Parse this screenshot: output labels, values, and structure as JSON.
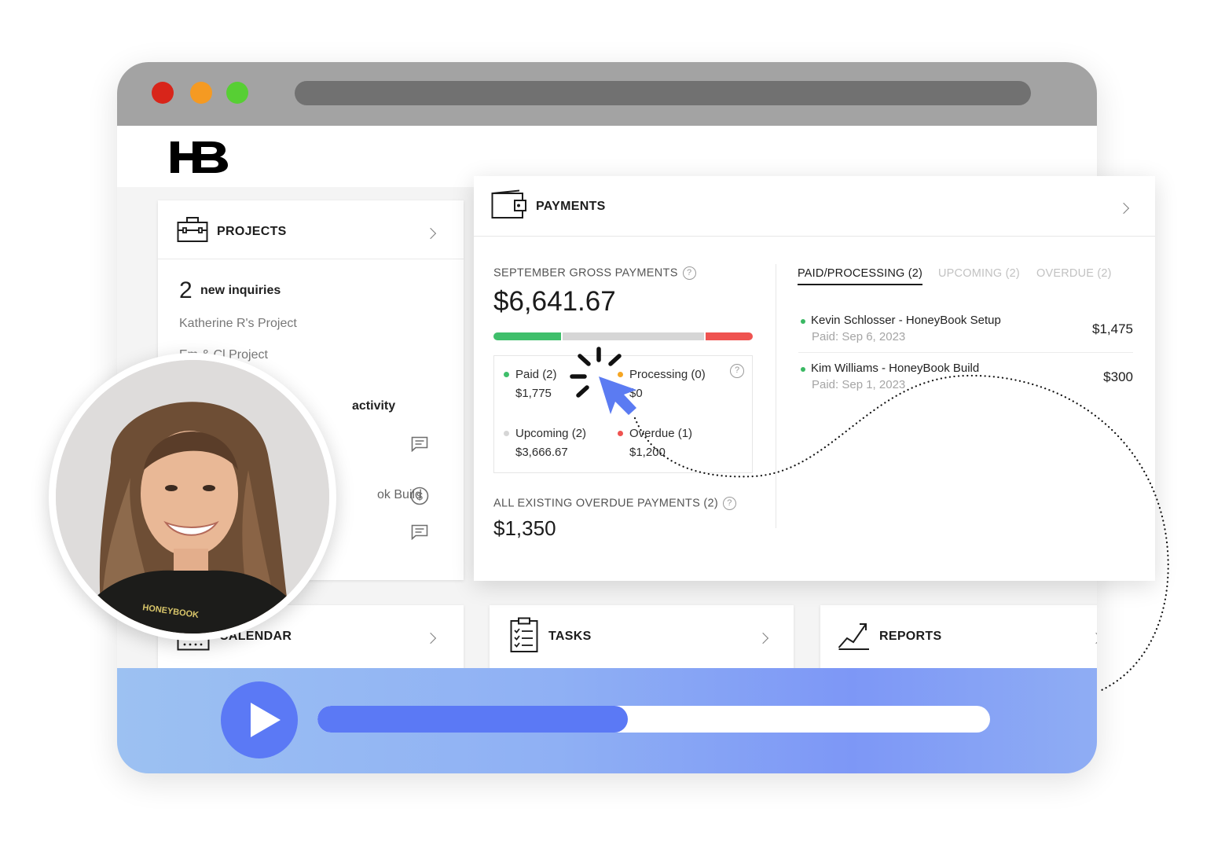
{
  "browser": {
    "colors": {
      "close": "#d8251a",
      "minimize": "#f59a22",
      "maximize": "#57cf34"
    }
  },
  "brand": {
    "logo_text": "HB"
  },
  "projects": {
    "title": "PROJECTS",
    "count": "2",
    "count_label": "new inquiries",
    "items": [
      "Katherine R's Project",
      "Em & Cl Project"
    ],
    "activity_label": "activity",
    "activity_item": "ok Build"
  },
  "payments": {
    "title": "PAYMENTS",
    "gross_label": "SEPTEMBER GROSS PAYMENTS",
    "gross_amount": "$6,641.67",
    "bar_fractions": {
      "paid": 0.267,
      "upcoming": 0.552,
      "overdue": 0.181
    },
    "colors": {
      "paid": "#3fbf6b",
      "processing": "#f5a623",
      "upcoming": "#d6d6d6",
      "overdue": "#ef5350"
    },
    "stats": {
      "paid_label": "Paid (2)",
      "paid_value": "$1,775",
      "processing_label": "Processing (0)",
      "processing_value": "$0",
      "upcoming_label": "Upcoming (2)",
      "upcoming_value": "$3,666.67",
      "overdue_label": "Overdue (1)",
      "overdue_value": "$1,200"
    },
    "overdue_all_label": "ALL EXISTING OVERDUE PAYMENTS (2)",
    "overdue_all_amount": "$1,350",
    "tabs": [
      "PAID/PROCESSING (2)",
      "UPCOMING (2)",
      "OVERDUE (2)"
    ],
    "rows": [
      {
        "name": "Kevin Schlosser - HoneyBook Setup",
        "date": "Paid: Sep 6, 2023",
        "amount": "$1,475"
      },
      {
        "name": "Kim Williams - HoneyBook Build",
        "date": "Paid: Sep 1, 2023",
        "amount": "$300"
      }
    ]
  },
  "calendar": {
    "title": "CALENDAR"
  },
  "tasks": {
    "title": "TASKS"
  },
  "reports": {
    "title": "REPORTS"
  },
  "player": {
    "progress": 0.462,
    "accent": "#5b79f5"
  },
  "avatar": {
    "shirt_text": "HONEYBOOK"
  }
}
